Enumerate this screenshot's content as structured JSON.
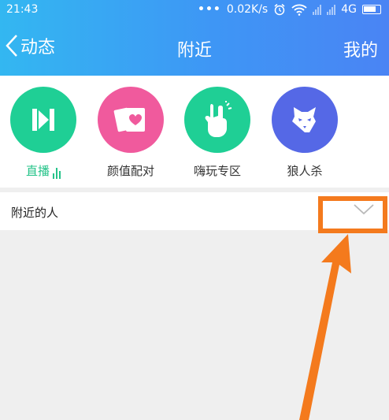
{
  "status_bar": {
    "time": "21:43",
    "dots": "•••",
    "speed": "0.02K/s",
    "network": "4G"
  },
  "nav": {
    "back_label": "动态",
    "title": "附近",
    "mine_label": "我的"
  },
  "categories": [
    {
      "label": "直播",
      "color": "#1fcf95",
      "icon": "live-stream-icon"
    },
    {
      "label": "颜值配对",
      "color": "#f05a9d",
      "icon": "cards-heart-icon"
    },
    {
      "label": "嗨玩专区",
      "color": "#1fcf95",
      "icon": "rock-hand-icon"
    },
    {
      "label": "狼人杀",
      "color": "#5568e6",
      "icon": "wolf-icon"
    }
  ],
  "nearby_section": {
    "label": "附近的人"
  },
  "colors": {
    "accent_green": "#25c389",
    "highlight_orange": "#f47a1d",
    "header_blue": "#3e96f5"
  }
}
